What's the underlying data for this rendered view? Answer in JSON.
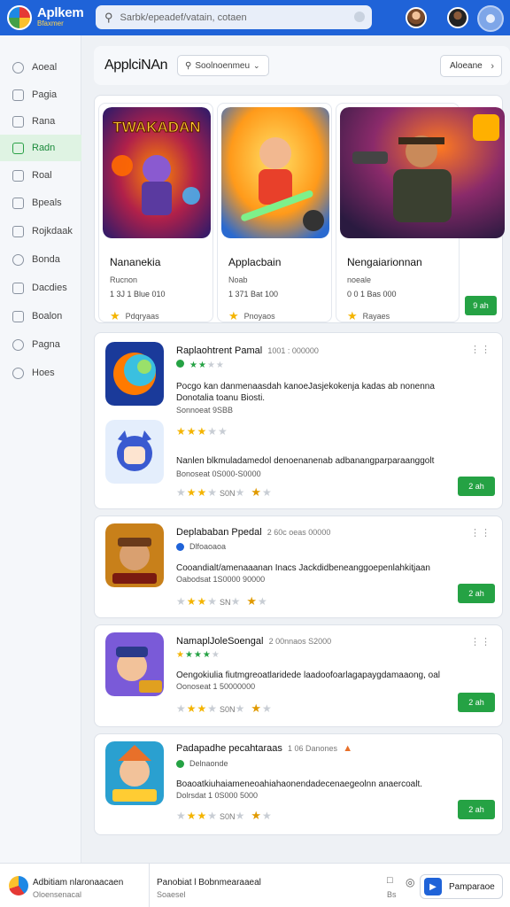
{
  "header": {
    "brand_name": "Aplkem",
    "brand_sub": "Bfaxmer",
    "search_placeholder": "Sarbk/epeadef/vatain, cotaen"
  },
  "sidebar": {
    "items": [
      {
        "label": "Aoeal",
        "active": false
      },
      {
        "label": "Pagia",
        "active": false
      },
      {
        "label": "Rana",
        "active": false
      },
      {
        "label": "Radn",
        "active": true
      },
      {
        "label": "Roal",
        "active": false
      },
      {
        "label": "Bpeals",
        "active": false
      },
      {
        "label": "Rojkdaak",
        "active": false
      },
      {
        "label": "Bonda",
        "active": false
      },
      {
        "label": "Dacdies",
        "active": false
      },
      {
        "label": "Boalon",
        "active": false
      },
      {
        "label": "Pagna",
        "active": false
      },
      {
        "label": "Hoes",
        "active": false
      }
    ]
  },
  "topbar": {
    "title": "ApplciNAn",
    "filter_label": "Soolnoenmeu",
    "button_label": "Aloeane"
  },
  "featured": {
    "cards": [
      {
        "title": "Nananekia",
        "sub": "Rucnon",
        "meta": "1 3J  1 Blue 010",
        "rating": "Pdqryaas"
      },
      {
        "title": "Applacbain",
        "sub": "Noab",
        "meta": "1 371  Bat 100",
        "rating": "Pnoyaos"
      },
      {
        "title": "Nengaiarionnan",
        "sub": "noeale",
        "meta": "0 0  1 Bas 000",
        "rating": "Rayaes"
      }
    ],
    "get_label": "9 ah"
  },
  "list": [
    {
      "title": "Raplaohtrent Pamal",
      "extra": "1001 : 000000",
      "sub": "",
      "desc": "Pocgo kan danmenaasdah kanoeJasjekokenja kadas ab nonenna Donotalia toanu Biosti.",
      "desc2": "Sonnoeat 9SBB",
      "desc_b": "Nanlen blkmuladamedol denoenanenab adbanangparparaanggolt",
      "desc2_b": "Bonoseat 0S000-S0000",
      "rating_cnt": "S0N",
      "rating_cnt_b": "",
      "get_label": "2 ah"
    },
    {
      "title": "Deplababan Ppedal",
      "extra": "2 60c  oeas  00000",
      "sub": "Dlfoaoaoa",
      "desc": "Cooandialt/amenaaanan Inacs Jackdidbeneanggoepenlahkitjaan",
      "desc2": "Oabodsat 1S0000 90000",
      "rating_cnt": "SN",
      "get_label": "2 ah"
    },
    {
      "title": "NamaplJoleSoengal",
      "extra": "2 00nnaos  S2000",
      "sub": "",
      "desc": "Oengokiulia fiutmgreoatlaridede laadoofoarlagapaygdamaaong, oal",
      "desc2": "Oonoseat 1 50000000",
      "rating_cnt": "S0N",
      "get_label": "2 ah"
    },
    {
      "title": "Padapadhe pecahtaraas",
      "extra": "1 06 Danones",
      "sub": "Delnaonde",
      "desc": "Boaoatkiuhaiameneoahiahaonendadecenaegeolnn anaercoalt.",
      "desc2": "Dolrsdat 1 0S000 5000",
      "rating_cnt": "S0N",
      "get_label": "2 ah"
    }
  ],
  "footer": {
    "left_line1": "Adbitiam nlaronaacaen",
    "left_line2": "Oloensenacal",
    "center_line1": "Panobiat l Bobnmearaaeal",
    "center_line2": "Soaesel",
    "icon_label": "Bs",
    "cta_label": "Pamparaoe"
  },
  "colors": {
    "header_blue": "#1f63d8",
    "accent_green": "#25a244",
    "star_yellow": "#f4b400"
  }
}
